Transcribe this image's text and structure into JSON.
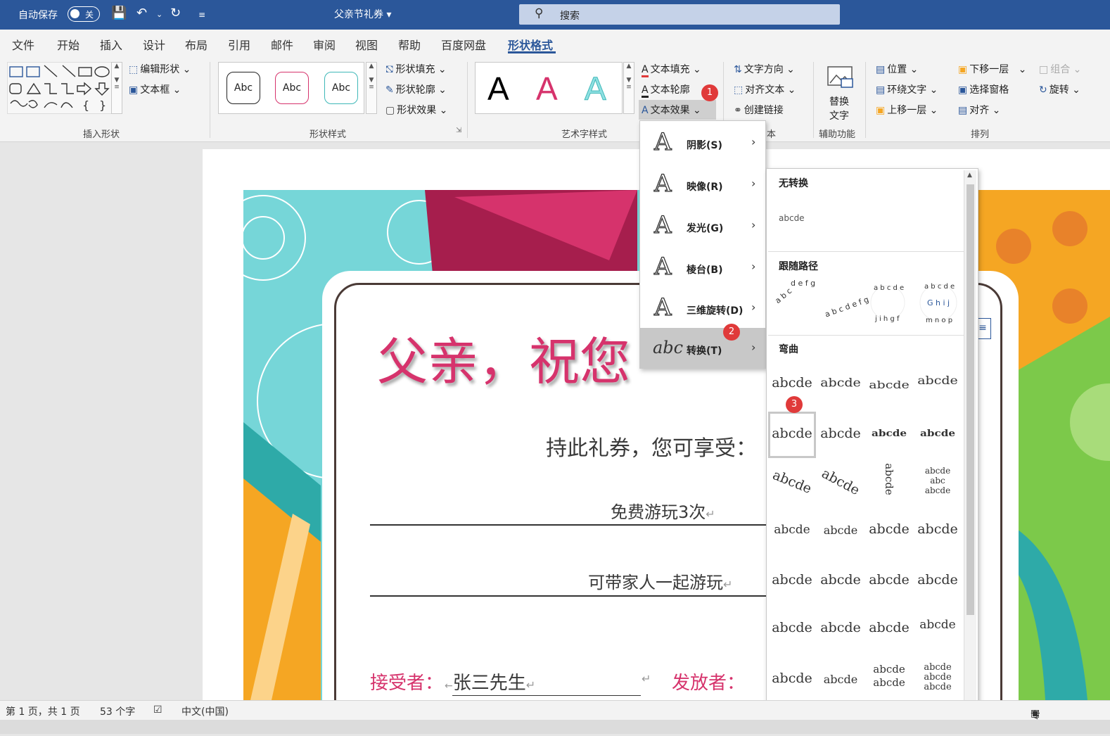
{
  "titlebar": {
    "autosave_label": "自动保存",
    "toggle_state": "关",
    "doc_title": "父亲节礼券",
    "search_placeholder": "搜索"
  },
  "menu": [
    "文件",
    "开始",
    "插入",
    "设计",
    "布局",
    "引用",
    "邮件",
    "审阅",
    "视图",
    "帮助",
    "百度网盘",
    "形状格式"
  ],
  "active_menu": "形状格式",
  "ribbon": {
    "insert_shapes": {
      "label": "插入形状",
      "edit_shape": "编辑形状",
      "text_box": "文本框"
    },
    "shape_styles": {
      "label": "形状样式",
      "samples": [
        "Abc",
        "Abc",
        "Abc"
      ],
      "fill": "形状填充",
      "outline": "形状轮廓",
      "effects": "形状效果"
    },
    "wordart": {
      "label": "艺术字样式",
      "text_fill": "文本填充",
      "text_outline": "文本轮廓",
      "text_effects": "文本效果",
      "letters": [
        "A",
        "A",
        "A"
      ]
    },
    "text": {
      "direction": "文字方向",
      "align_text": "对齐文本",
      "create_link": "创建链接",
      "label_tail": "本"
    },
    "accessibility": {
      "alt_text_1": "替换",
      "alt_text_2": "文字",
      "label": "辅助功能"
    },
    "arrange": {
      "position": "位置",
      "wrap_text": "环绕文字",
      "bring_forward": "上移一层",
      "send_backward": "下移一层",
      "selection_pane": "选择窗格",
      "align": "对齐",
      "group": "组合",
      "rotate": "旋转",
      "label": "排列"
    }
  },
  "document": {
    "title": "父亲，祝",
    "title_tail": "您",
    "subtitle": "持此礼券，您可享受：",
    "line1": "免费游玩3次",
    "line2": "可带家人一起游玩",
    "recipient_label": "接受者：",
    "recipient_value": "张三先生",
    "sender_label": "发放者："
  },
  "effects_menu": [
    {
      "label": "阴影(S)",
      "icon": "shadow-icon"
    },
    {
      "label": "映像(R)",
      "icon": "reflection-icon"
    },
    {
      "label": "发光(G)",
      "icon": "glow-icon"
    },
    {
      "label": "棱台(B)",
      "icon": "bevel-icon"
    },
    {
      "label": "三维旋转(D)",
      "icon": "3d-rotation-icon"
    },
    {
      "label": "转换(T)",
      "icon": "transform-icon"
    }
  ],
  "transform_panel": {
    "no_transform": "无转换",
    "no_transform_sample": "abcde",
    "follow_path": "跟随路径",
    "warp": "弯曲",
    "warp_sample": "abcde"
  },
  "badges": [
    "1",
    "2",
    "3"
  ],
  "status": {
    "page": "第 1 页，共 1 页",
    "words": "53 个字",
    "language": "中文(中国)",
    "focus": "专注"
  },
  "colors": {
    "accent": "#2b579a",
    "title_pink": "#d6336c",
    "teal": "#76d6d8",
    "orange": "#f5a623",
    "badge": "#e03a3a"
  }
}
